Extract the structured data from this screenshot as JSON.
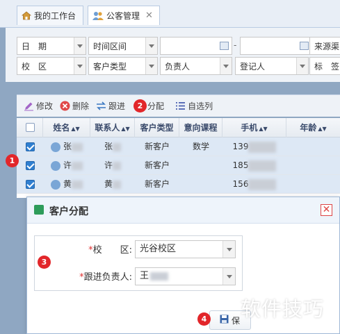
{
  "tabs": [
    {
      "label": "我的工作台",
      "icon": "home-icon"
    },
    {
      "label": "公客管理",
      "icon": "people-icon",
      "close": "✕"
    }
  ],
  "filters": {
    "row1": [
      {
        "label": "日　期"
      },
      {
        "label": "时间区间"
      },
      {
        "label": ""
      },
      {
        "dash": "-"
      },
      {
        "label": ""
      },
      {
        "label": "来源渠"
      }
    ],
    "row2": [
      {
        "label": "校　区"
      },
      {
        "label": "客户类型"
      },
      {
        "label": "负责人"
      },
      {
        "label": "登记人"
      },
      {
        "label": "标　签"
      }
    ]
  },
  "toolbar": {
    "edit": "修改",
    "delete": "删除",
    "followup": "跟进",
    "assign": "分配",
    "custom": "自选列"
  },
  "grid": {
    "columns": [
      "姓名",
      "联系人",
      "客户类型",
      "意向课程",
      "手机",
      "年龄"
    ],
    "rows": [
      {
        "name": "张",
        "contact": "张",
        "type": "新客户",
        "course": "数学",
        "phone": "139",
        "checked": true
      },
      {
        "name": "许",
        "contact": "许",
        "type": "新客户",
        "course": "",
        "phone": "185",
        "checked": true
      },
      {
        "name": "黄",
        "contact": "黄",
        "type": "新客户",
        "course": "",
        "phone": "156",
        "checked": true
      }
    ]
  },
  "dialog": {
    "title": "客户分配",
    "campus_label": "校　　区:",
    "campus_value": "光谷校区",
    "owner_label": "跟进负责人:",
    "owner_value": "王",
    "save": "保"
  },
  "markers": [
    "1",
    "2",
    "3",
    "4"
  ],
  "watermark": "软件技巧",
  "colors": {
    "accent": "#2f7fd1",
    "marker": "#e2262a",
    "required": "#e03030"
  }
}
